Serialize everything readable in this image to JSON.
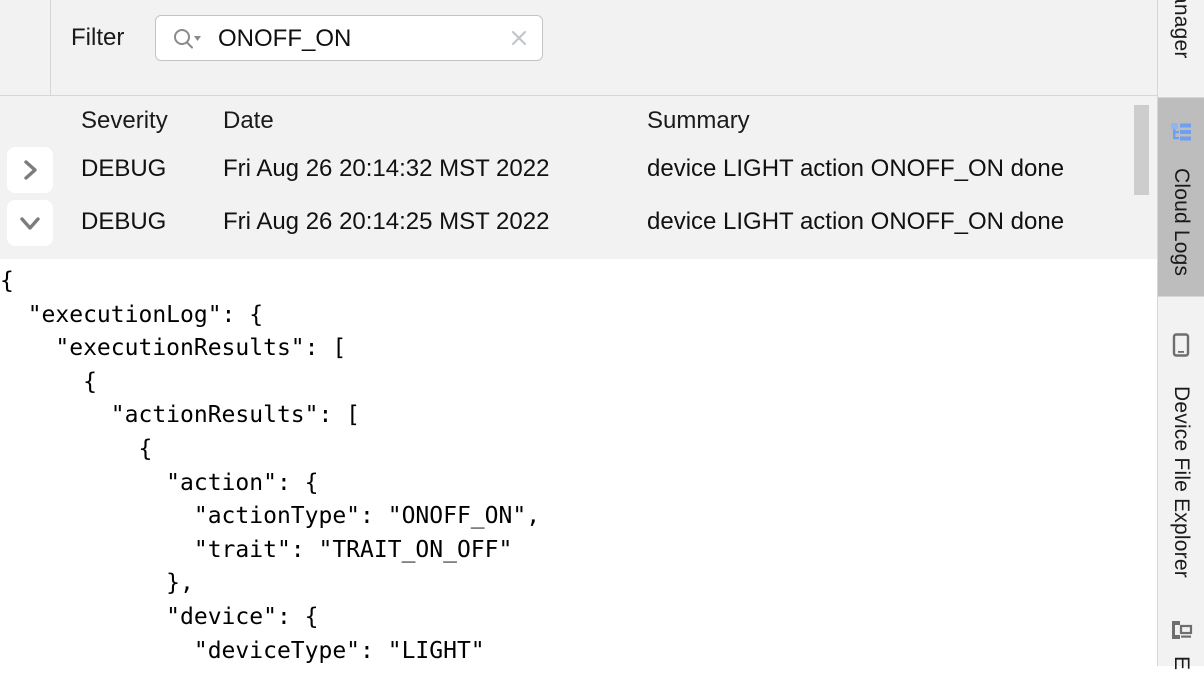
{
  "toolbar": {
    "filter_label": "Filter",
    "search_icon": "search-dropdown-icon",
    "filter_value": "ONOFF_ON",
    "filter_placeholder": "Filter",
    "clear_icon": "close-icon"
  },
  "table": {
    "columns": [
      "Severity",
      "Date",
      "Summary"
    ],
    "rows": [
      {
        "expander_icon": "chevron-right-icon",
        "expanded": "false",
        "severity": "DEBUG",
        "date": "Fri Aug 26 20:14:32 MST 2022",
        "summary": "device LIGHT action ONOFF_ON done"
      },
      {
        "expander_icon": "chevron-down-icon",
        "expanded": "true",
        "severity": "DEBUG",
        "date": "Fri Aug 26 20:14:25 MST 2022",
        "summary": "device LIGHT action ONOFF_ON done"
      }
    ]
  },
  "detail": {
    "json_text": "{\n  \"executionLog\": {\n    \"executionResults\": [\n      {\n        \"actionResults\": [\n          {\n            \"action\": {\n              \"actionType\": \"ONOFF_ON\",\n              \"trait\": \"TRAIT_ON_OFF\"\n            },\n            \"device\": {\n              \"deviceType\": \"LIGHT\""
  },
  "sidebar": {
    "tabs": [
      {
        "label": "anager",
        "icon": "device-manager-icon",
        "selected": "false",
        "truncated": "true"
      },
      {
        "label": "Cloud Logs",
        "icon": "cloud-logs-list-icon",
        "selected": "true",
        "truncated": "false"
      },
      {
        "label": "Device File Explorer",
        "icon": "phone-device-icon",
        "selected": "false",
        "truncated": "false"
      },
      {
        "label": "E",
        "icon": "emulator-icon",
        "selected": "false",
        "truncated": "true"
      }
    ]
  },
  "colors": {
    "toolbar_bg": "#f2f2f2",
    "panel_bg": "#ffffff",
    "selected_tab_bg": "#bdbdbd",
    "accent_blue": "#7aa7f0",
    "scrollbar_thumb": "#cdcdcd",
    "border": "#d6d6d6",
    "text": "#1a1a1a"
  }
}
